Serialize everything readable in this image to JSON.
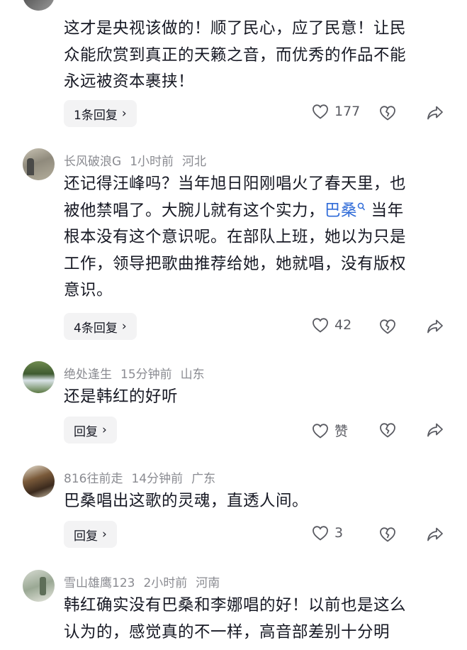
{
  "comments": [
    {
      "text_lines": [
        "这才是央视该做的！顺了民心，应了民意！让民",
        "众能欣赏到真正的天籁之音，而优秀的作品不能",
        "永远被资本裹挟！"
      ],
      "reply_label": "1条回复",
      "likes": "177"
    },
    {
      "user": "长风破浪G",
      "time": "1小时前",
      "location": "河北",
      "line1": "还记得汪峰吗？当年旭日阳刚唱火了春天里，也",
      "line2_a": "被他禁唱了。大腕儿就有这个实力，",
      "link": "巴桑",
      "line2_b": " 当年",
      "line3": "根本没有这个意识呢。在部队上班，她以为只是",
      "line4": "工作，领导把歌曲推荐给她，她就唱，没有版权",
      "line5": "意识。",
      "reply_label": "4条回复",
      "likes": "42"
    },
    {
      "user": "绝处逢生",
      "time": "15分钟前",
      "location": "山东",
      "text": "还是韩红的好听",
      "reply_label": "回复",
      "likes": "赞"
    },
    {
      "user": "816往前走",
      "time": "14分钟前",
      "location": "广东",
      "text": "巴桑唱出这歌的灵魂，直透人间。",
      "reply_label": "回复",
      "likes": "3"
    },
    {
      "user": "雪山雄鹰123",
      "time": "2小时前",
      "location": "河南",
      "text_lines": [
        "韩红确实没有巴桑和李娜唱的好！以前也是这么",
        "认为的，感觉真的不一样，高音部差别十分明"
      ]
    }
  ],
  "icons": {
    "like": "heart-icon",
    "dislike": "broken-heart-icon",
    "share": "share-arrow-icon",
    "search_hint": "search-icon",
    "chevron": "chevron-right-icon"
  },
  "colors": {
    "text": "#161823",
    "meta": "#8a8b91",
    "link": "#2f6bd8",
    "reply_bg": "#f3f3f4"
  }
}
